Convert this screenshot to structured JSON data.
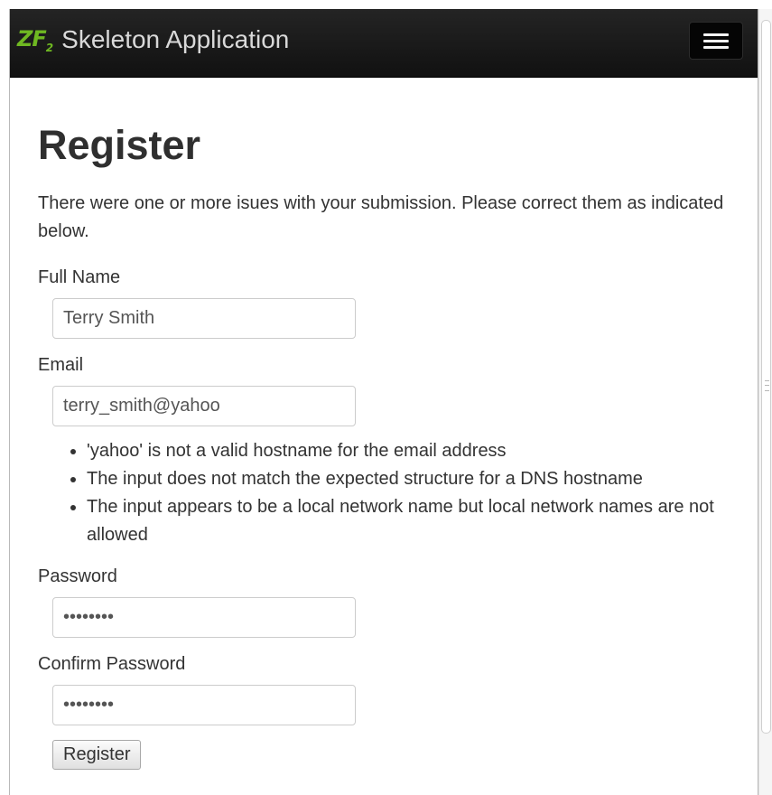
{
  "navbar": {
    "logo_text": "ZF",
    "logo_sub": "2",
    "brand": "Skeleton Application",
    "menu_icon": "hamburger-icon"
  },
  "page": {
    "title": "Register",
    "error_message": "There were one or more isues with your submission. Please correct them as indicated below."
  },
  "form": {
    "full_name": {
      "label": "Full Name",
      "value": "Terry Smith"
    },
    "email": {
      "label": "Email",
      "value": "terry_smith@yahoo",
      "errors": [
        "'yahoo' is not a valid hostname for the email address",
        "The input does not match the expected structure for a DNS hostname",
        "The input appears to be a local network name but local network names are not allowed"
      ]
    },
    "password": {
      "label": "Password",
      "value": "••••••••"
    },
    "confirm_password": {
      "label": "Confirm Password",
      "value": "••••••••"
    },
    "submit_label": "Register"
  },
  "colors": {
    "navbar_bg": "#1b1b1b",
    "logo_green": "#6fb822",
    "text": "#333333"
  }
}
